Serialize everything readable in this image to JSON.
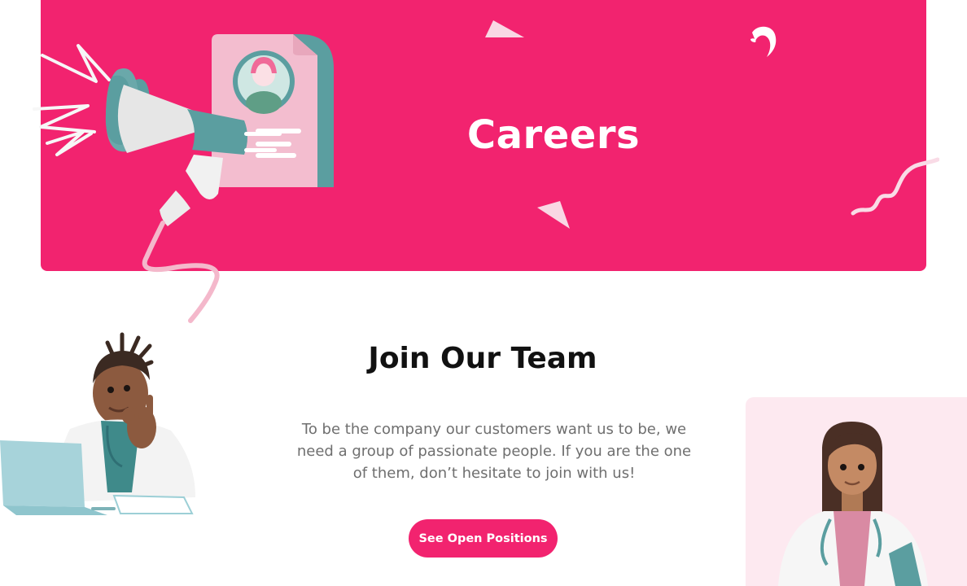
{
  "hero": {
    "title": "Careers",
    "accent_color": "#f2236f"
  },
  "join": {
    "title": "Join Our Team",
    "text": "To be the company our customers want us to be, we need a group of passionate people. If you are the one of them, don’t hesitate to join with us!",
    "cta_label": "See Open Positions"
  },
  "icons": [
    "megaphone-icon",
    "resume-card-icon",
    "confetti-triangle-icon",
    "squiggle-icon"
  ]
}
